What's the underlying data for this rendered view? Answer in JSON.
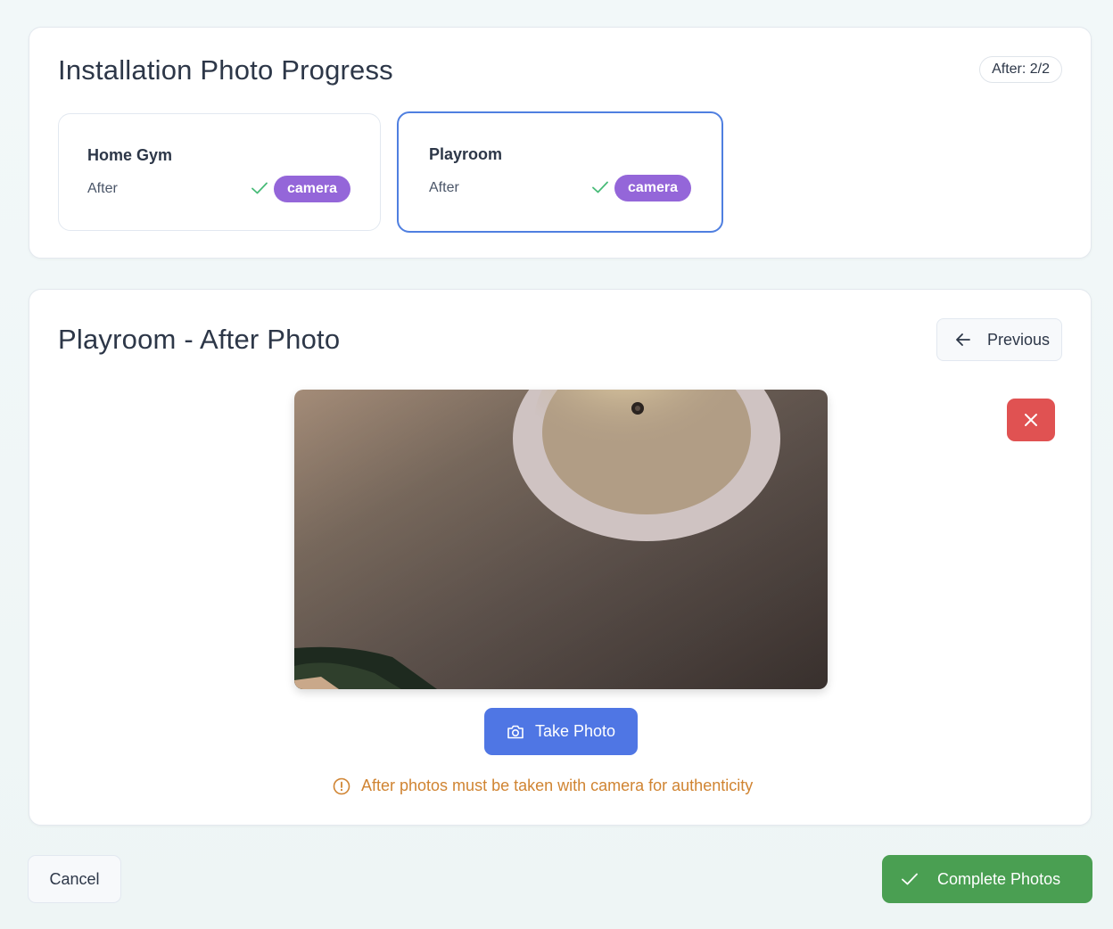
{
  "progress": {
    "title": "Installation Photo Progress",
    "count_badge": "After: 2/2",
    "rooms": [
      {
        "name": "Home Gym",
        "phase": "After",
        "status_icon": "check-icon",
        "source": "camera"
      },
      {
        "name": "Playroom",
        "phase": "After",
        "status_icon": "check-icon",
        "source": "camera"
      }
    ]
  },
  "capture": {
    "title": "Playroom - After Photo",
    "previous_label": "Previous",
    "take_photo_label": "Take Photo",
    "notice": "After photos must be taken with camera for authenticity"
  },
  "footer": {
    "cancel_label": "Cancel",
    "complete_label": "Complete Photos"
  },
  "colors": {
    "accent_blue": "#4f76e4",
    "selected_border": "#4f7fe0",
    "camera_pill": "#9466d9",
    "check_green": "#48bb78",
    "danger_red": "#e05252",
    "warning_orange": "#d08432",
    "success_green": "#4a9f52"
  }
}
